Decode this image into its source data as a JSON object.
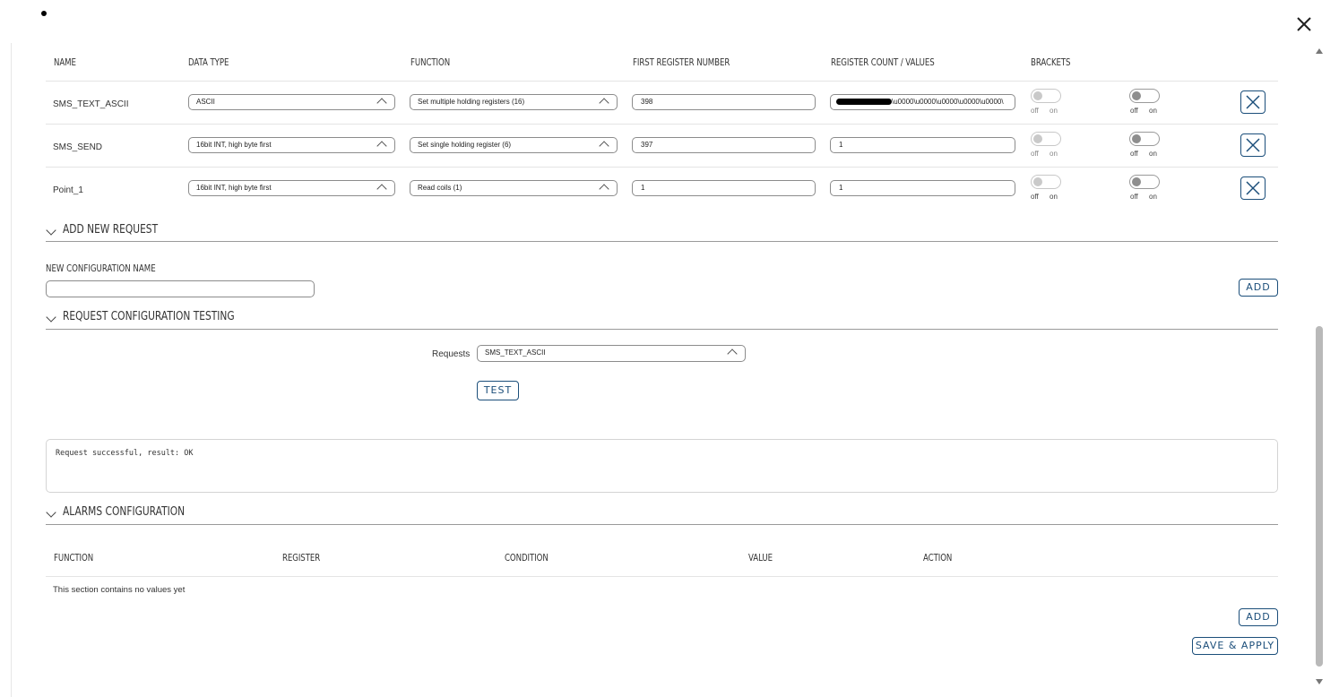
{
  "modal": {
    "close_icon": "close-icon",
    "bullet": "•"
  },
  "table": {
    "headers": [
      "NAME",
      "DATA TYPE",
      "FUNCTION",
      "FIRST REGISTER NUMBER",
      "REGISTER COUNT / VALUES",
      "BRACKETS"
    ],
    "rows": [
      {
        "name": "SMS_TEXT_ASCII",
        "data_type": "ASCII",
        "function": "Set multiple holding registers (16)",
        "first_register": "398",
        "count_values": "\\u0000\\u0000\\u0000\\u0000\\u0000\\"
      },
      {
        "name": "SMS_SEND",
        "data_type": "16bit INT, high byte first",
        "function": "Set single holding register (6)",
        "first_register": "397",
        "count_values": "1"
      },
      {
        "name": "Point_1",
        "data_type": "16bit INT, high byte first",
        "function": "Read coils (1)",
        "first_register": "1",
        "count_values": "1"
      }
    ],
    "toggle_off": "off",
    "toggle_on": "on"
  },
  "add_request": {
    "title": "ADD NEW REQUEST",
    "name_label": "NEW CONFIGURATION NAME",
    "name_value": "",
    "add_label": "ADD"
  },
  "testing": {
    "title": "REQUEST CONFIGURATION TESTING",
    "requests_label": "Requests",
    "selected_request": "SMS_TEXT_ASCII",
    "test_label": "TEST",
    "result": "Request successful, result: OK"
  },
  "alarms": {
    "title": "ALARMS CONFIGURATION",
    "headers": [
      "FUNCTION",
      "REGISTER",
      "CONDITION",
      "VALUE",
      "ACTION"
    ],
    "empty": "This section contains no values yet",
    "add_label": "ADD"
  },
  "footer": {
    "save_label": "SAVE & APPLY"
  },
  "colors": {
    "accent": "#1b4e7a",
    "border": "#8c8c8c",
    "line": "#e4e4e4"
  }
}
